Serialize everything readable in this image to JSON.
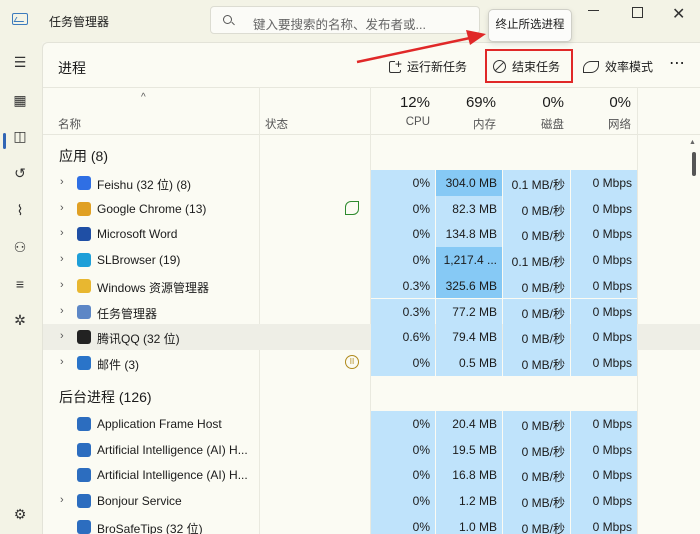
{
  "app": {
    "title": "任务管理器"
  },
  "search": {
    "placeholder": "键入要搜索的名称、发布者或..."
  },
  "popup": {
    "label": "终止所选进程"
  },
  "page": {
    "title": "进程"
  },
  "toolbar": {
    "run_new_task": "运行新任务",
    "end_task": "结束任务",
    "efficiency_mode": "效率模式",
    "more": "⋯"
  },
  "header": {
    "sort_caret": "^",
    "name": "名称",
    "status": "状态",
    "cpu_pct": "12%",
    "cpu": "CPU",
    "mem_pct": "69%",
    "mem": "内存",
    "disk_pct": "0%",
    "disk": "磁盘",
    "net_pct": "0%",
    "net": "网络"
  },
  "groups": {
    "apps": "应用 (8)",
    "background": "后台进程 (126)"
  },
  "apps": [
    {
      "name": "Feishu (32 位) (8)",
      "icon": "feishu-icon",
      "color": "#2f6fe4",
      "cpu": "0%",
      "mem": "304.0 MB",
      "disk": "0.1 MB/秒",
      "net": "0 Mbps",
      "mem_hot": true
    },
    {
      "name": "Google Chrome (13)",
      "icon": "chrome-icon",
      "color": "#e0a024",
      "cpu": "0%",
      "mem": "82.3 MB",
      "disk": "0 MB/秒",
      "net": "0 Mbps",
      "status": "efficiency-leaf-icon"
    },
    {
      "name": "Microsoft Word",
      "icon": "word-icon",
      "color": "#1f4fa5",
      "cpu": "0%",
      "mem": "134.8 MB",
      "disk": "0 MB/秒",
      "net": "0 Mbps"
    },
    {
      "name": "SLBrowser (19)",
      "icon": "slbrowser-icon",
      "color": "#1e9fd8",
      "cpu": "0%",
      "mem": "1,217.4 ...",
      "disk": "0.1 MB/秒",
      "net": "0 Mbps",
      "mem_hot": true
    },
    {
      "name": "Windows 资源管理器",
      "icon": "explorer-icon",
      "color": "#e8b730",
      "cpu": "0.3%",
      "mem": "325.6 MB",
      "disk": "0 MB/秒",
      "net": "0 Mbps",
      "mem_hot": true
    },
    {
      "name": "任务管理器",
      "icon": "task-manager-icon",
      "color": "#5d87c6",
      "cpu": "0.3%",
      "mem": "77.2 MB",
      "disk": "0 MB/秒",
      "net": "0 Mbps"
    },
    {
      "name": "腾讯QQ (32 位)",
      "icon": "qq-icon",
      "color": "#222222",
      "cpu": "0.6%",
      "mem": "79.4 MB",
      "disk": "0 MB/秒",
      "net": "0 Mbps",
      "highlight": true
    },
    {
      "name": "邮件 (3)",
      "icon": "mail-icon",
      "color": "#2a74c9",
      "cpu": "0%",
      "mem": "0.5 MB",
      "disk": "0 MB/秒",
      "net": "0 Mbps",
      "status": "paused-icon"
    }
  ],
  "background": [
    {
      "name": "Application Frame Host",
      "icon": "app-frame-icon",
      "color": "#2c6dbf",
      "cpu": "0%",
      "mem": "20.4 MB",
      "disk": "0 MB/秒",
      "net": "0 Mbps",
      "expand": false
    },
    {
      "name": "Artificial Intelligence (AI) H...",
      "icon": "ai-host-icon",
      "color": "#2c6dbf",
      "cpu": "0%",
      "mem": "19.5 MB",
      "disk": "0 MB/秒",
      "net": "0 Mbps",
      "expand": false
    },
    {
      "name": "Artificial Intelligence (AI) H...",
      "icon": "ai-host-icon",
      "color": "#2c6dbf",
      "cpu": "0%",
      "mem": "16.8 MB",
      "disk": "0 MB/秒",
      "net": "0 Mbps",
      "expand": false
    },
    {
      "name": "Bonjour Service",
      "icon": "bonjour-icon",
      "color": "#2c6dbf",
      "cpu": "0%",
      "mem": "1.2 MB",
      "disk": "0 MB/秒",
      "net": "0 Mbps",
      "expand": true
    },
    {
      "name": "BroSafeTips (32 位)",
      "icon": "brosafe-icon",
      "color": "#2c6dbf",
      "cpu": "0%",
      "mem": "1.0 MB",
      "disk": "0 MB/秒",
      "net": "0 Mbps",
      "expand": false
    }
  ]
}
